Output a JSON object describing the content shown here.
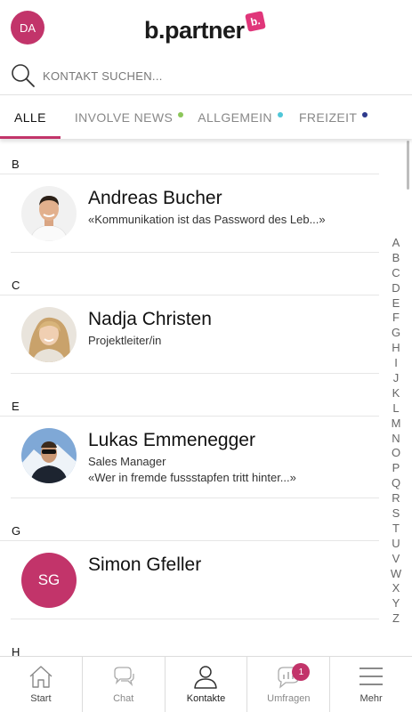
{
  "header": {
    "user_initials": "DA",
    "logo_text": "b.partner",
    "logo_badge": "b."
  },
  "search": {
    "placeholder": "KONTAKT SUCHEN..."
  },
  "tabs": [
    {
      "label": "ALLE",
      "active": true
    },
    {
      "label": "INVOLVE NEWS",
      "dot_color": "#8cc65a"
    },
    {
      "label": "ALLGEMEIN",
      "dot_color": "#4fc6d8"
    },
    {
      "label": "FREIZEIT",
      "dot_color": "#2e3a8c"
    }
  ],
  "sections": [
    {
      "letter": "B",
      "contacts": [
        {
          "name": "Andreas Bucher",
          "line1": "«Kommunikation ist das Password des Leb...»",
          "photo": "man-white-shirt"
        }
      ]
    },
    {
      "letter": "C",
      "contacts": [
        {
          "name": "Nadja Christen",
          "line1": "Projektleiter/in",
          "photo": "blond-woman"
        }
      ]
    },
    {
      "letter": "E",
      "contacts": [
        {
          "name": "Lukas Emmenegger",
          "line1": "Sales Manager",
          "line2": "«Wer in fremde fussstapfen tritt hinter...»",
          "photo": "man-sunglasses-mountains"
        }
      ]
    },
    {
      "letter": "G",
      "contacts": [
        {
          "name": "Simon Gfeller",
          "initials": "SG"
        }
      ]
    },
    {
      "letter": "H",
      "contacts": []
    }
  ],
  "alphabet": [
    "A",
    "B",
    "C",
    "D",
    "E",
    "F",
    "G",
    "H",
    "I",
    "J",
    "K",
    "L",
    "M",
    "N",
    "O",
    "P",
    "Q",
    "R",
    "S",
    "T",
    "U",
    "V",
    "W",
    "X",
    "Y",
    "Z"
  ],
  "bottom_nav": [
    {
      "label": "Start",
      "icon": "home-icon"
    },
    {
      "label": "Chat",
      "icon": "chat-icon"
    },
    {
      "label": "Kontakte",
      "icon": "person-icon",
      "active": true
    },
    {
      "label": "Umfragen",
      "icon": "poll-chat-icon",
      "badge": "1"
    },
    {
      "label": "Mehr",
      "icon": "menu-icon"
    }
  ],
  "colors": {
    "accent": "#c2346a",
    "logo_badge": "#e0367a"
  }
}
